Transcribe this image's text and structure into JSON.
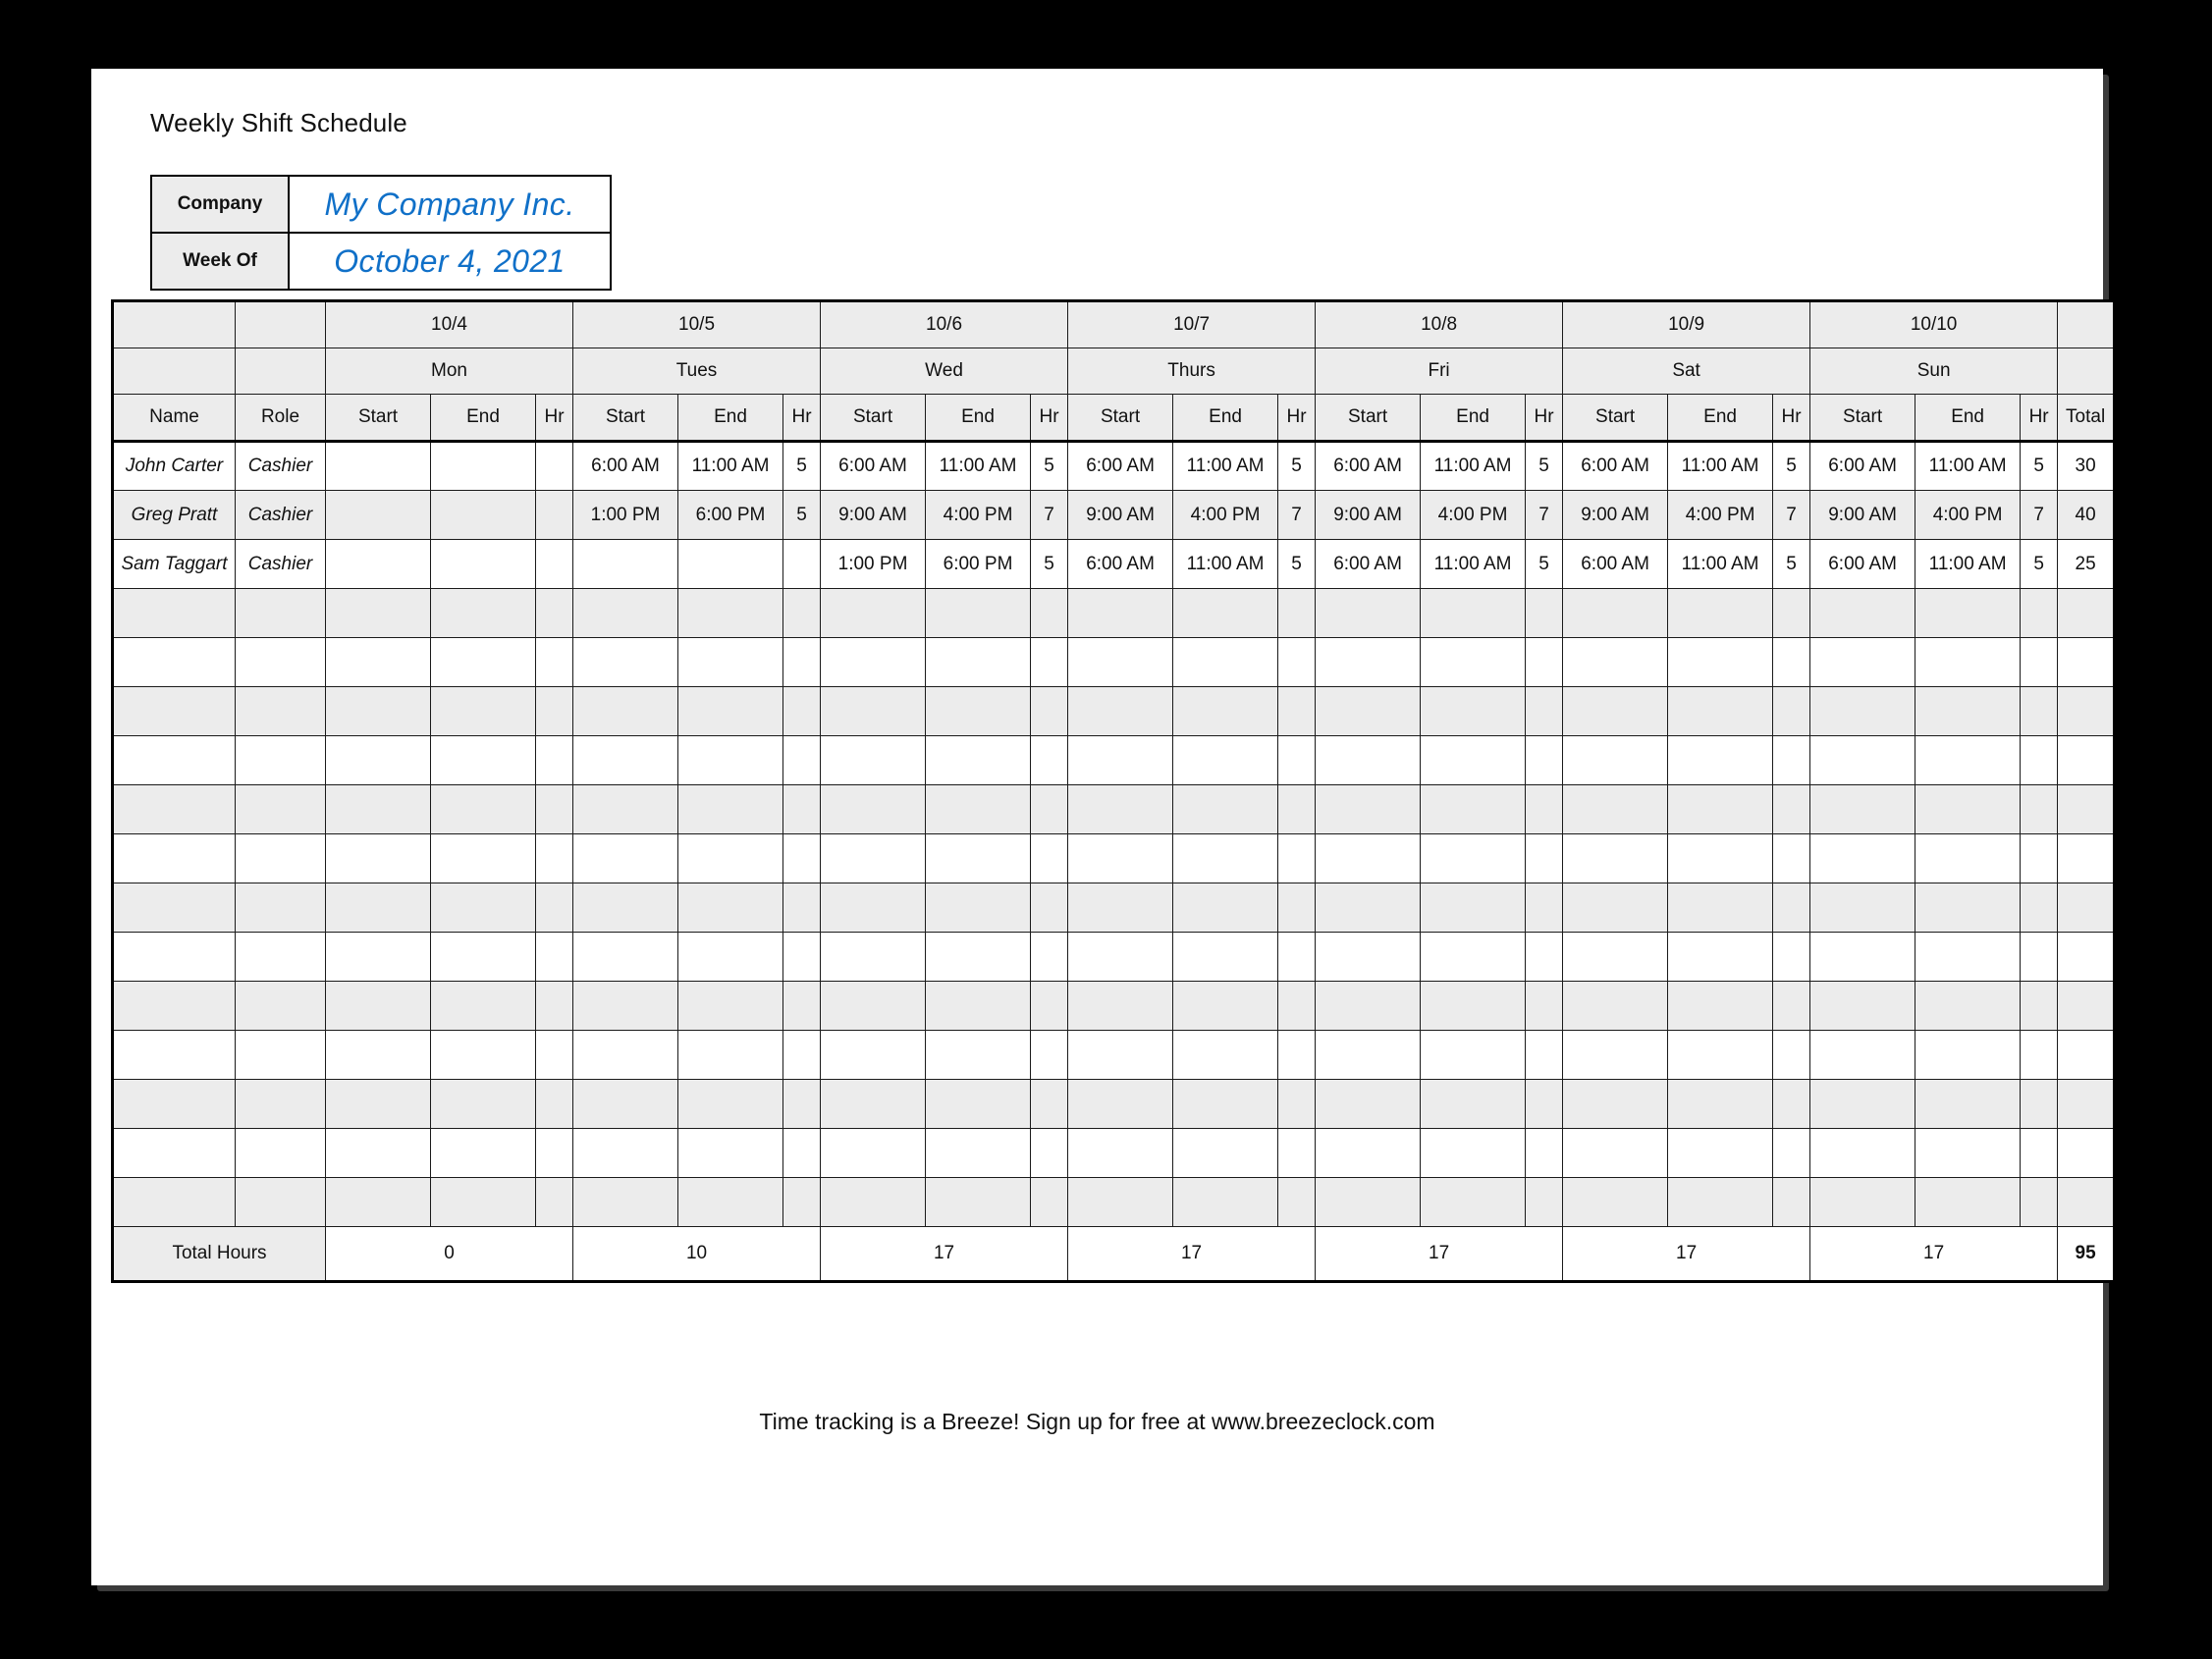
{
  "document": {
    "title": "Weekly Shift Schedule",
    "footer_note": "Time tracking is a Breeze! Sign up for free at www.breezeclock.com"
  },
  "meta": {
    "company_label": "Company",
    "company_value": "My Company Inc.",
    "week_of_label": "Week Of",
    "week_of_value": "October 4, 2021"
  },
  "colors": {
    "accent_blue": "#1070c8",
    "header_fill": "#ececec",
    "band_fill": "#ececec",
    "grid_line": "#1a1a1a",
    "page_background": "#000000",
    "sheet": "#ffffff"
  },
  "table": {
    "corner_headers": [
      "Name",
      "Role"
    ],
    "sub_headers": [
      "Start",
      "End",
      "Hr"
    ],
    "total_header": "Total",
    "total_hours_label": "Total Hours",
    "days": [
      {
        "date": "10/4",
        "day": "Mon"
      },
      {
        "date": "10/5",
        "day": "Tues"
      },
      {
        "date": "10/6",
        "day": "Wed"
      },
      {
        "date": "10/7",
        "day": "Thurs"
      },
      {
        "date": "10/8",
        "day": "Fri"
      },
      {
        "date": "10/9",
        "day": "Sat"
      },
      {
        "date": "10/10",
        "day": "Sun"
      }
    ],
    "rows": [
      {
        "name": "John Carter",
        "role": "Cashier",
        "shifts": [
          {
            "start": "",
            "end": "",
            "hr": ""
          },
          {
            "start": "6:00 AM",
            "end": "11:00 AM",
            "hr": "5"
          },
          {
            "start": "6:00 AM",
            "end": "11:00 AM",
            "hr": "5"
          },
          {
            "start": "6:00 AM",
            "end": "11:00 AM",
            "hr": "5"
          },
          {
            "start": "6:00 AM",
            "end": "11:00 AM",
            "hr": "5"
          },
          {
            "start": "6:00 AM",
            "end": "11:00 AM",
            "hr": "5"
          },
          {
            "start": "6:00 AM",
            "end": "11:00 AM",
            "hr": "5"
          }
        ],
        "total": "30"
      },
      {
        "name": "Greg Pratt",
        "role": "Cashier",
        "shifts": [
          {
            "start": "",
            "end": "",
            "hr": ""
          },
          {
            "start": "1:00 PM",
            "end": "6:00 PM",
            "hr": "5"
          },
          {
            "start": "9:00 AM",
            "end": "4:00 PM",
            "hr": "7"
          },
          {
            "start": "9:00 AM",
            "end": "4:00 PM",
            "hr": "7"
          },
          {
            "start": "9:00 AM",
            "end": "4:00 PM",
            "hr": "7"
          },
          {
            "start": "9:00 AM",
            "end": "4:00 PM",
            "hr": "7"
          },
          {
            "start": "9:00 AM",
            "end": "4:00 PM",
            "hr": "7"
          }
        ],
        "total": "40"
      },
      {
        "name": "Sam Taggart",
        "role": "Cashier",
        "shifts": [
          {
            "start": "",
            "end": "",
            "hr": ""
          },
          {
            "start": "",
            "end": "",
            "hr": ""
          },
          {
            "start": "1:00 PM",
            "end": "6:00 PM",
            "hr": "5"
          },
          {
            "start": "6:00 AM",
            "end": "11:00 AM",
            "hr": "5"
          },
          {
            "start": "6:00 AM",
            "end": "11:00 AM",
            "hr": "5"
          },
          {
            "start": "6:00 AM",
            "end": "11:00 AM",
            "hr": "5"
          },
          {
            "start": "6:00 AM",
            "end": "11:00 AM",
            "hr": "5"
          }
        ],
        "total": "25"
      }
    ],
    "empty_row_count": 13,
    "day_totals": [
      "0",
      "10",
      "17",
      "17",
      "17",
      "17",
      "17"
    ],
    "grand_total": "95"
  }
}
